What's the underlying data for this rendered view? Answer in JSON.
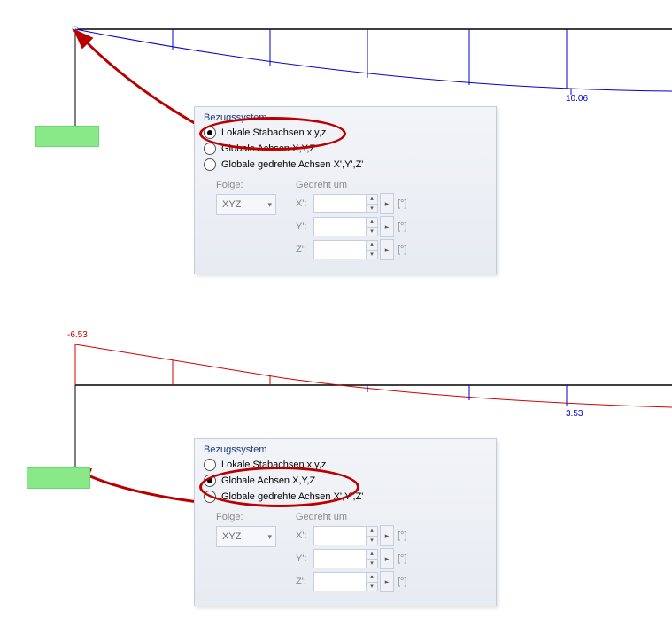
{
  "panel": {
    "title": "Bezugssystem",
    "radios": {
      "local": "Lokale Stabachsen x,y,z",
      "global": "Globale Achsen X,Y,Z",
      "rotated": "Globale gedrehte Achsen X',Y',Z'"
    },
    "folge_label": "Folge:",
    "folge_value": "XYZ",
    "gedreht_label": "Gedreht um",
    "axes": {
      "x": "X':",
      "y": "Y':",
      "z": "Z':"
    },
    "unit": "[°]"
  },
  "diagram": {
    "top_value": "10.06",
    "bottom_value_red": "-6.53",
    "bottom_value_blue": "3.53"
  }
}
